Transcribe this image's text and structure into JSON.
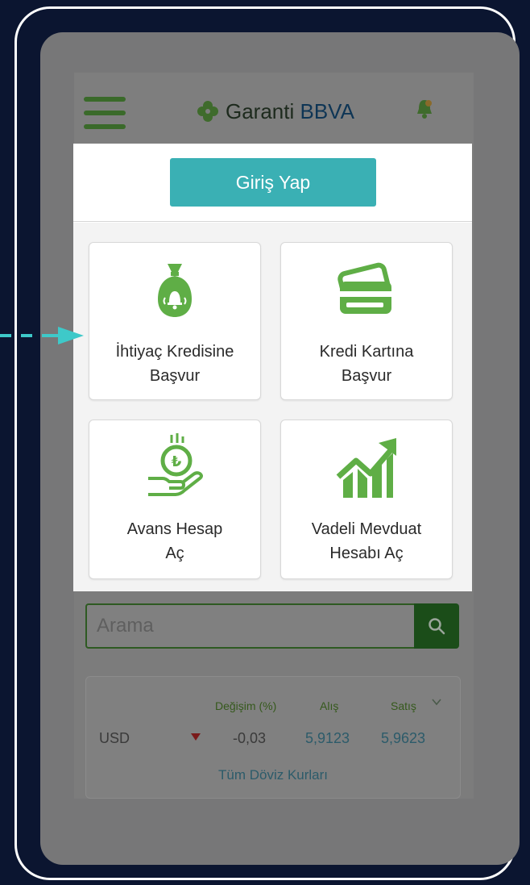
{
  "header": {
    "logo_brand": "Garanti",
    "logo_suffix": "BBVA"
  },
  "login": {
    "button_label": "Giriş Yap"
  },
  "tiles": [
    {
      "line1": "İhtiyaç Kredisine",
      "line2": "Başvur",
      "icon": "money-bag-icon"
    },
    {
      "line1": "Kredi Kartına",
      "line2": "Başvur",
      "icon": "credit-card-icon"
    },
    {
      "line1": "Avans Hesap",
      "line2": "Aç",
      "icon": "coin-hand-icon"
    },
    {
      "line1": "Vadeli Mevduat",
      "line2": "Hesabı Aç",
      "icon": "growth-chart-icon"
    }
  ],
  "search": {
    "placeholder": "Arama"
  },
  "fx": {
    "col_change": "Değişim (%)",
    "col_buy": "Alış",
    "col_sell": "Satış",
    "currency": "USD",
    "change": "-0,03",
    "buy": "5,9123",
    "sell": "5,9623",
    "link": "Tüm Döviz Kurları"
  },
  "colors": {
    "brand_green": "#5fae46",
    "login_teal": "#3ab0b4",
    "pointer_arrow": "#3ec9c9",
    "background": "#0b1530"
  }
}
